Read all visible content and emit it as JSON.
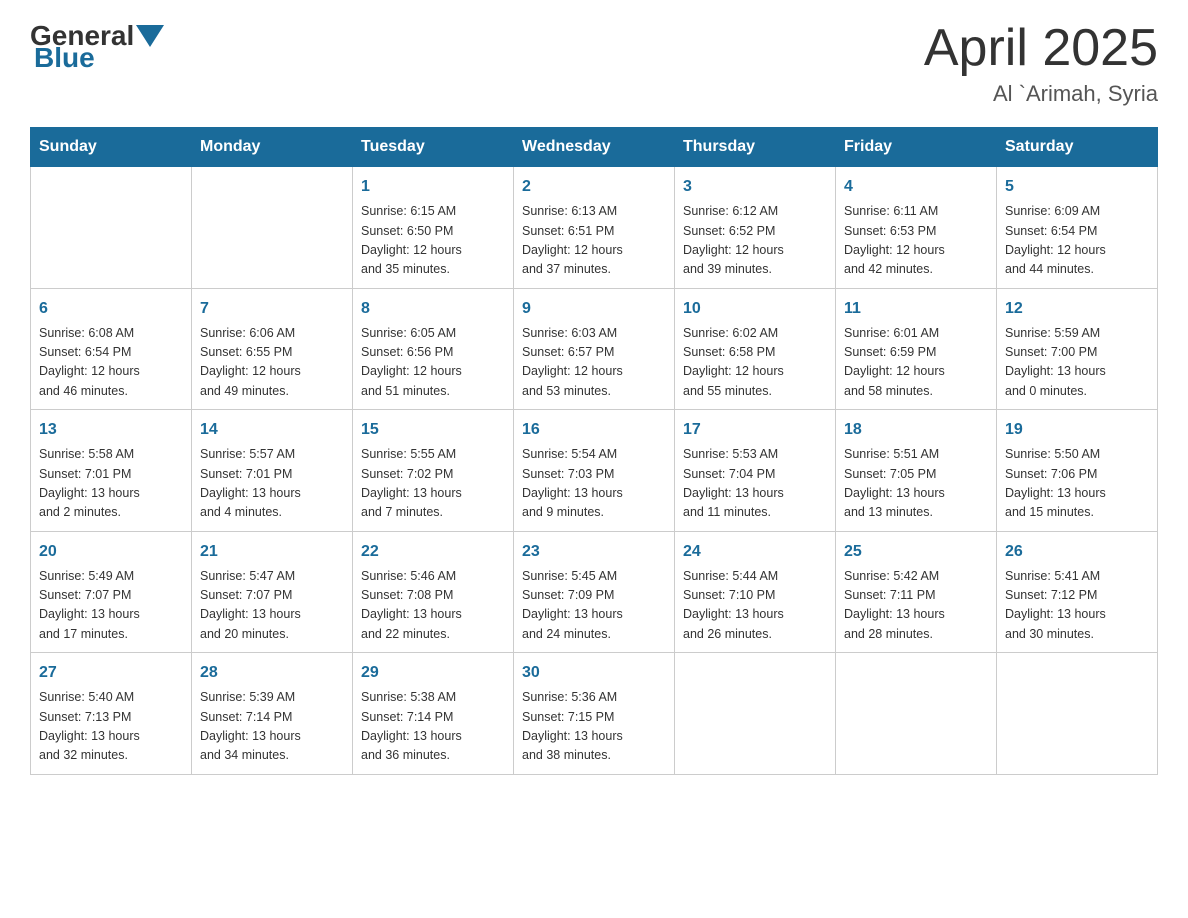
{
  "header": {
    "logo_general": "General",
    "logo_blue": "Blue",
    "month_title": "April 2025",
    "location": "Al `Arimah, Syria"
  },
  "days_of_week": [
    "Sunday",
    "Monday",
    "Tuesday",
    "Wednesday",
    "Thursday",
    "Friday",
    "Saturday"
  ],
  "weeks": [
    [
      {
        "day": "",
        "info": ""
      },
      {
        "day": "",
        "info": ""
      },
      {
        "day": "1",
        "info": "Sunrise: 6:15 AM\nSunset: 6:50 PM\nDaylight: 12 hours\nand 35 minutes."
      },
      {
        "day": "2",
        "info": "Sunrise: 6:13 AM\nSunset: 6:51 PM\nDaylight: 12 hours\nand 37 minutes."
      },
      {
        "day": "3",
        "info": "Sunrise: 6:12 AM\nSunset: 6:52 PM\nDaylight: 12 hours\nand 39 minutes."
      },
      {
        "day": "4",
        "info": "Sunrise: 6:11 AM\nSunset: 6:53 PM\nDaylight: 12 hours\nand 42 minutes."
      },
      {
        "day": "5",
        "info": "Sunrise: 6:09 AM\nSunset: 6:54 PM\nDaylight: 12 hours\nand 44 minutes."
      }
    ],
    [
      {
        "day": "6",
        "info": "Sunrise: 6:08 AM\nSunset: 6:54 PM\nDaylight: 12 hours\nand 46 minutes."
      },
      {
        "day": "7",
        "info": "Sunrise: 6:06 AM\nSunset: 6:55 PM\nDaylight: 12 hours\nand 49 minutes."
      },
      {
        "day": "8",
        "info": "Sunrise: 6:05 AM\nSunset: 6:56 PM\nDaylight: 12 hours\nand 51 minutes."
      },
      {
        "day": "9",
        "info": "Sunrise: 6:03 AM\nSunset: 6:57 PM\nDaylight: 12 hours\nand 53 minutes."
      },
      {
        "day": "10",
        "info": "Sunrise: 6:02 AM\nSunset: 6:58 PM\nDaylight: 12 hours\nand 55 minutes."
      },
      {
        "day": "11",
        "info": "Sunrise: 6:01 AM\nSunset: 6:59 PM\nDaylight: 12 hours\nand 58 minutes."
      },
      {
        "day": "12",
        "info": "Sunrise: 5:59 AM\nSunset: 7:00 PM\nDaylight: 13 hours\nand 0 minutes."
      }
    ],
    [
      {
        "day": "13",
        "info": "Sunrise: 5:58 AM\nSunset: 7:01 PM\nDaylight: 13 hours\nand 2 minutes."
      },
      {
        "day": "14",
        "info": "Sunrise: 5:57 AM\nSunset: 7:01 PM\nDaylight: 13 hours\nand 4 minutes."
      },
      {
        "day": "15",
        "info": "Sunrise: 5:55 AM\nSunset: 7:02 PM\nDaylight: 13 hours\nand 7 minutes."
      },
      {
        "day": "16",
        "info": "Sunrise: 5:54 AM\nSunset: 7:03 PM\nDaylight: 13 hours\nand 9 minutes."
      },
      {
        "day": "17",
        "info": "Sunrise: 5:53 AM\nSunset: 7:04 PM\nDaylight: 13 hours\nand 11 minutes."
      },
      {
        "day": "18",
        "info": "Sunrise: 5:51 AM\nSunset: 7:05 PM\nDaylight: 13 hours\nand 13 minutes."
      },
      {
        "day": "19",
        "info": "Sunrise: 5:50 AM\nSunset: 7:06 PM\nDaylight: 13 hours\nand 15 minutes."
      }
    ],
    [
      {
        "day": "20",
        "info": "Sunrise: 5:49 AM\nSunset: 7:07 PM\nDaylight: 13 hours\nand 17 minutes."
      },
      {
        "day": "21",
        "info": "Sunrise: 5:47 AM\nSunset: 7:07 PM\nDaylight: 13 hours\nand 20 minutes."
      },
      {
        "day": "22",
        "info": "Sunrise: 5:46 AM\nSunset: 7:08 PM\nDaylight: 13 hours\nand 22 minutes."
      },
      {
        "day": "23",
        "info": "Sunrise: 5:45 AM\nSunset: 7:09 PM\nDaylight: 13 hours\nand 24 minutes."
      },
      {
        "day": "24",
        "info": "Sunrise: 5:44 AM\nSunset: 7:10 PM\nDaylight: 13 hours\nand 26 minutes."
      },
      {
        "day": "25",
        "info": "Sunrise: 5:42 AM\nSunset: 7:11 PM\nDaylight: 13 hours\nand 28 minutes."
      },
      {
        "day": "26",
        "info": "Sunrise: 5:41 AM\nSunset: 7:12 PM\nDaylight: 13 hours\nand 30 minutes."
      }
    ],
    [
      {
        "day": "27",
        "info": "Sunrise: 5:40 AM\nSunset: 7:13 PM\nDaylight: 13 hours\nand 32 minutes."
      },
      {
        "day": "28",
        "info": "Sunrise: 5:39 AM\nSunset: 7:14 PM\nDaylight: 13 hours\nand 34 minutes."
      },
      {
        "day": "29",
        "info": "Sunrise: 5:38 AM\nSunset: 7:14 PM\nDaylight: 13 hours\nand 36 minutes."
      },
      {
        "day": "30",
        "info": "Sunrise: 5:36 AM\nSunset: 7:15 PM\nDaylight: 13 hours\nand 38 minutes."
      },
      {
        "day": "",
        "info": ""
      },
      {
        "day": "",
        "info": ""
      },
      {
        "day": "",
        "info": ""
      }
    ]
  ]
}
